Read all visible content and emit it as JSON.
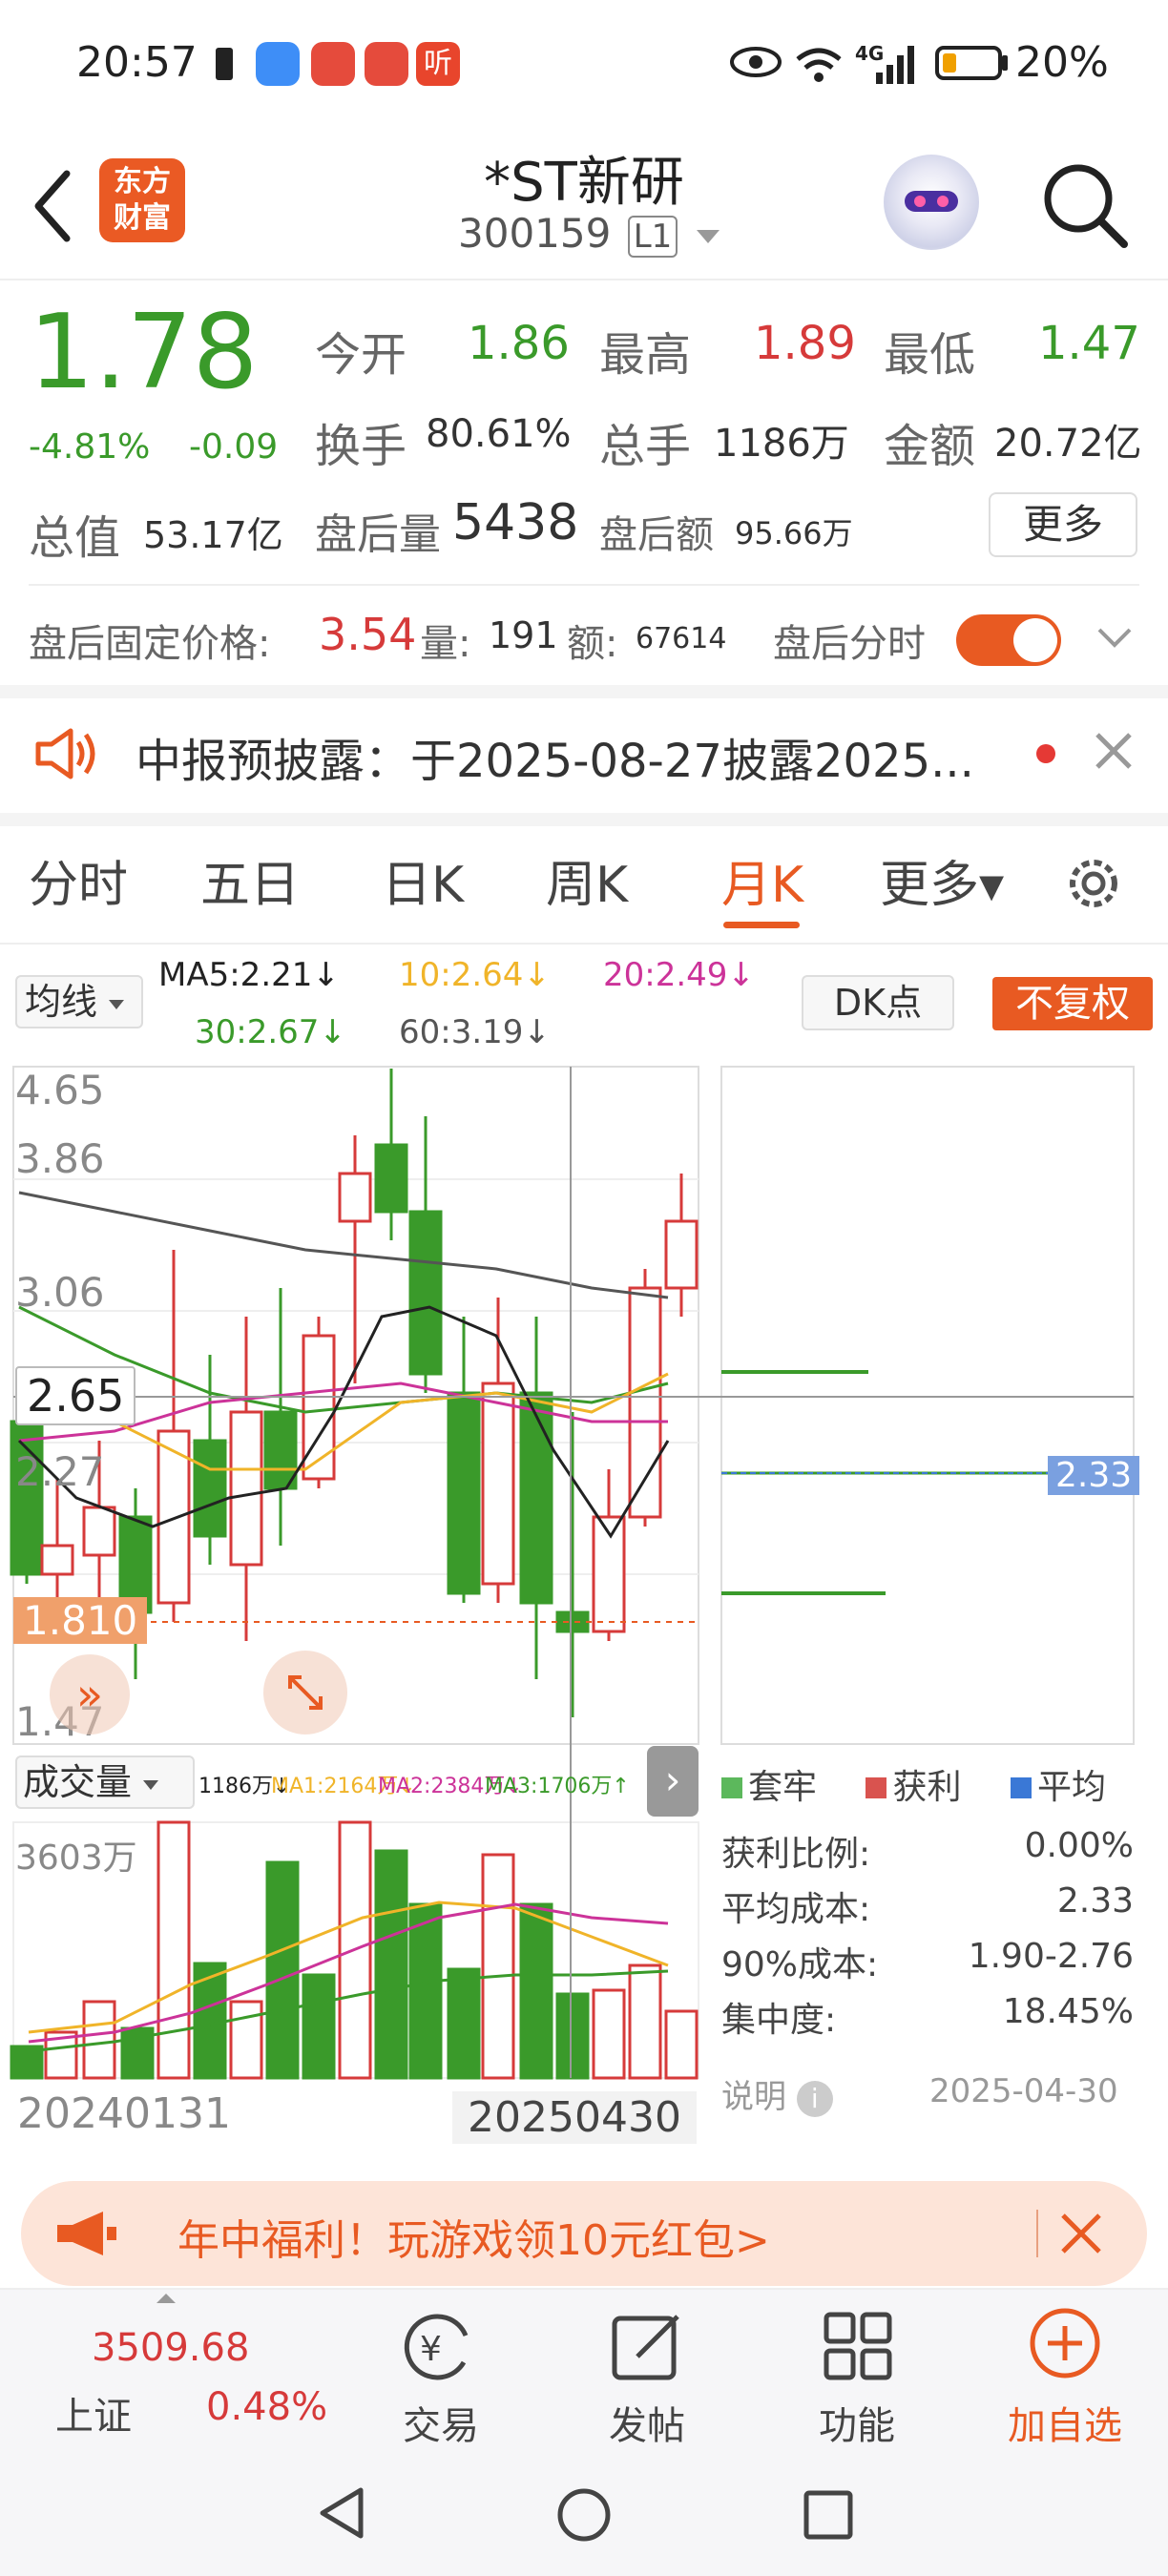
{
  "status_bar": {
    "time": "20:57",
    "battery": "20%",
    "signal_label": "4G",
    "notification_icons": [
      "battery-alert-icon",
      "message-icon",
      "app-icon-1",
      "app-icon-2",
      "listen-app-icon"
    ]
  },
  "header": {
    "title": "*ST新研",
    "code": "300159",
    "level": "L1",
    "logo_text_line1": "东方",
    "logo_text_line2": "财富"
  },
  "quote": {
    "price": "1.78",
    "change_pct": "-4.81%",
    "change": "-0.09",
    "open_label": "今开",
    "open": "1.86",
    "high_label": "最高",
    "high": "1.89",
    "low_label": "最低",
    "low": "1.47",
    "turnover_label": "换手",
    "turnover": "80.61%",
    "volume_label": "总手",
    "volume": "1186万",
    "amount_label": "金额",
    "amount": "20.72亿",
    "mcap_label": "总值",
    "mcap": "53.17亿",
    "after_vol_label": "盘后量",
    "after_vol": "5438",
    "after_amt_label": "盘后额",
    "after_amt": "95.66万",
    "more_button": "更多"
  },
  "after_hours": {
    "price_label": "盘后固定价格:",
    "price": "3.54",
    "vol_label": "量:",
    "vol": "191",
    "amt_label": "额:",
    "amt": "67614",
    "toggle_label": "盘后分时"
  },
  "notice": {
    "text": "中报预披露：于2025-08-27披露2025..."
  },
  "tabs": [
    "分时",
    "五日",
    "日K",
    "周K",
    "月K",
    "更多▾"
  ],
  "active_tab": "月K",
  "ma_bar": {
    "select_label": "均线",
    "ma5": "MA5:2.21↓",
    "ma10": "10:2.64↓",
    "ma20": "20:2.49↓",
    "ma30": "30:2.67↓",
    "ma60": "60:3.19↓",
    "dk_button": "DK点",
    "fq_button": "不复权"
  },
  "kline": {
    "y_labels": [
      "4.65",
      "3.86",
      "3.06",
      "2.27",
      "1.47"
    ],
    "crosshair_price": "2.65",
    "last_price_tag": "1.810",
    "colors": {
      "up": "#d63a3a",
      "down": "#3a9a2a",
      "ma5": "#222222",
      "ma10": "#f0b429",
      "ma20": "#cc3399",
      "ma30": "#3a9a2a",
      "ma60": "#555555"
    }
  },
  "chip": {
    "cost_tag": "2.33",
    "legend": [
      "套牢",
      "获利",
      "平均"
    ],
    "rows": [
      {
        "label": "获利比例:",
        "value": "0.00%"
      },
      {
        "label": "平均成本:",
        "value": "2.33"
      },
      {
        "label": "90%成本:",
        "value": "1.90-2.76"
      },
      {
        "label": "集中度:",
        "value": "18.45%"
      }
    ],
    "note_label": "说明",
    "date": "2025-04-30"
  },
  "volume_panel": {
    "select_label": "成交量",
    "vol_text": "1186万↓",
    "ma1_text": "MA1:2164万↓",
    "ma2_text": "MA2:2384万↓",
    "ma3_text": "MA3:1706万↑",
    "max_label": "3603万",
    "date_start": "20240131",
    "date_cursor": "20250430"
  },
  "banner": {
    "text": "年中福利！玩游戏领10元红包>"
  },
  "bottom_bar": {
    "index_value": "3509.68",
    "index_name": "上证",
    "index_change": "0.48%",
    "items": [
      "交易",
      "发帖",
      "功能",
      "加自选"
    ]
  }
}
